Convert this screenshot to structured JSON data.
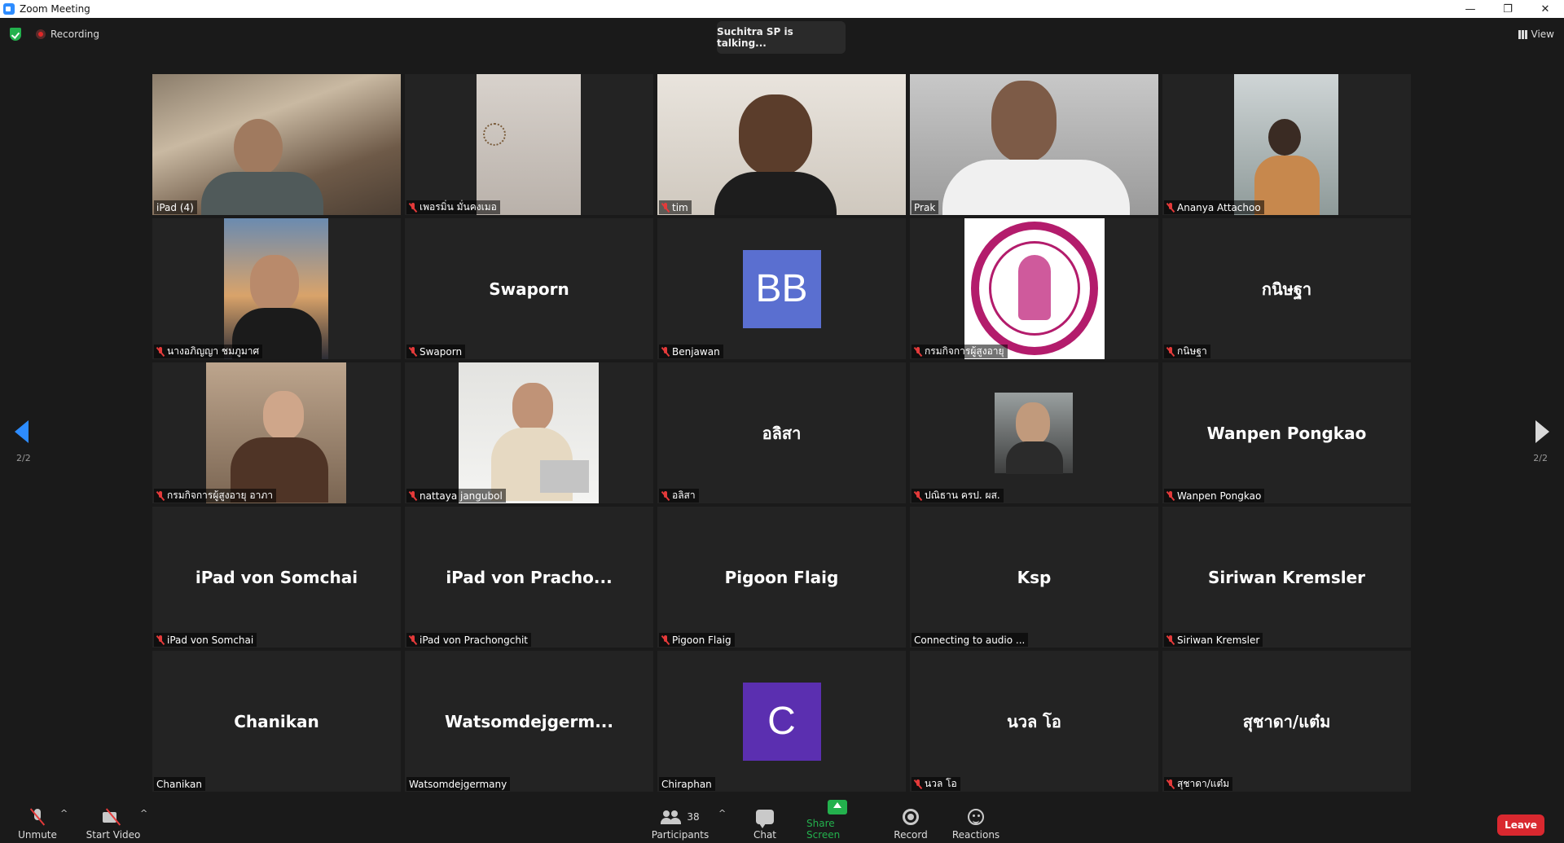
{
  "window": {
    "title": "Zoom Meeting",
    "controls": [
      "—",
      "❐",
      "✕"
    ]
  },
  "meeting": {
    "recording_label": "Recording",
    "talking_banner": "Suchitra SP is talking...",
    "view_label": "View",
    "page_indicator_left": "2/2",
    "page_indicator_right": "2/2"
  },
  "tiles": [
    {
      "label": "iPad (4)",
      "muted": false,
      "video": "v1"
    },
    {
      "label": "เพอรมิ่น มั่นคงเมอ",
      "muted": true,
      "video": "v2"
    },
    {
      "label": "tim",
      "muted": true,
      "video": "v3"
    },
    {
      "label": "Prak",
      "muted": false,
      "video": "v4"
    },
    {
      "label": "Ananya Attachoo",
      "muted": true,
      "video": "v5"
    },
    {
      "label": "นางอภิญญา ชมภูมาศ",
      "muted": true,
      "video": "v6"
    },
    {
      "label": "Swaporn",
      "muted": true,
      "big_name": "Swaporn"
    },
    {
      "label": "Benjawan",
      "muted": true,
      "avatar": "BB",
      "avatar_color": "#5a6fd0"
    },
    {
      "label": "กรมกิจการผู้สูงอายุ",
      "muted": true,
      "video": "v7"
    },
    {
      "label": "กนิษฐา",
      "muted": true,
      "big_name": "กนิษฐา"
    },
    {
      "label": "กรมกิจการผู้สูงอายุ อาภา",
      "muted": true,
      "video": "v8"
    },
    {
      "label": "nattaya jangubol",
      "muted": true,
      "video": "v9"
    },
    {
      "label": "อลิสา",
      "muted": true,
      "big_name": "อลิสา"
    },
    {
      "label": "ปณิธาน ครป. ผส.",
      "muted": true,
      "video": "v10"
    },
    {
      "label": "Wanpen Pongkao",
      "muted": true,
      "big_name": "Wanpen Pongkao"
    },
    {
      "label": "iPad von Somchai",
      "muted": true,
      "big_name": "iPad von Somchai"
    },
    {
      "label": "iPad von Prachongchit",
      "muted": true,
      "big_name": "iPad von Pracho..."
    },
    {
      "label": "Pigoon Flaig",
      "muted": true,
      "big_name": "Pigoon Flaig"
    },
    {
      "label": "Connecting to audio ...",
      "muted": false,
      "big_name": "Ksp"
    },
    {
      "label": "Siriwan Kremsler",
      "muted": true,
      "big_name": "Siriwan Kremsler"
    },
    {
      "label": "Chanikan",
      "muted": false,
      "big_name": "Chanikan"
    },
    {
      "label": "Watsomdejgermany",
      "muted": false,
      "big_name": "Watsomdejgerm..."
    },
    {
      "label": "Chiraphan",
      "muted": false,
      "avatar": "C",
      "avatar_color": "#5b2fb0"
    },
    {
      "label": "นวล โอ",
      "muted": true,
      "big_name": "นวล โอ"
    },
    {
      "label": "สุชาดา/แต๋ม",
      "muted": true,
      "big_name": "สุชาดา/แต๋ม"
    }
  ],
  "toolbar": {
    "unmute": "Unmute",
    "start_video": "Start Video",
    "participants": "Participants",
    "participants_count": "38",
    "chat": "Chat",
    "share_screen": "Share Screen",
    "record": "Record",
    "reactions": "Reactions",
    "leave": "Leave",
    "caret": "^"
  },
  "colors": {
    "accent": "#2d8cff",
    "leave": "#d9282f",
    "share": "#23b14d",
    "muted_icon": "#e43a3a"
  }
}
